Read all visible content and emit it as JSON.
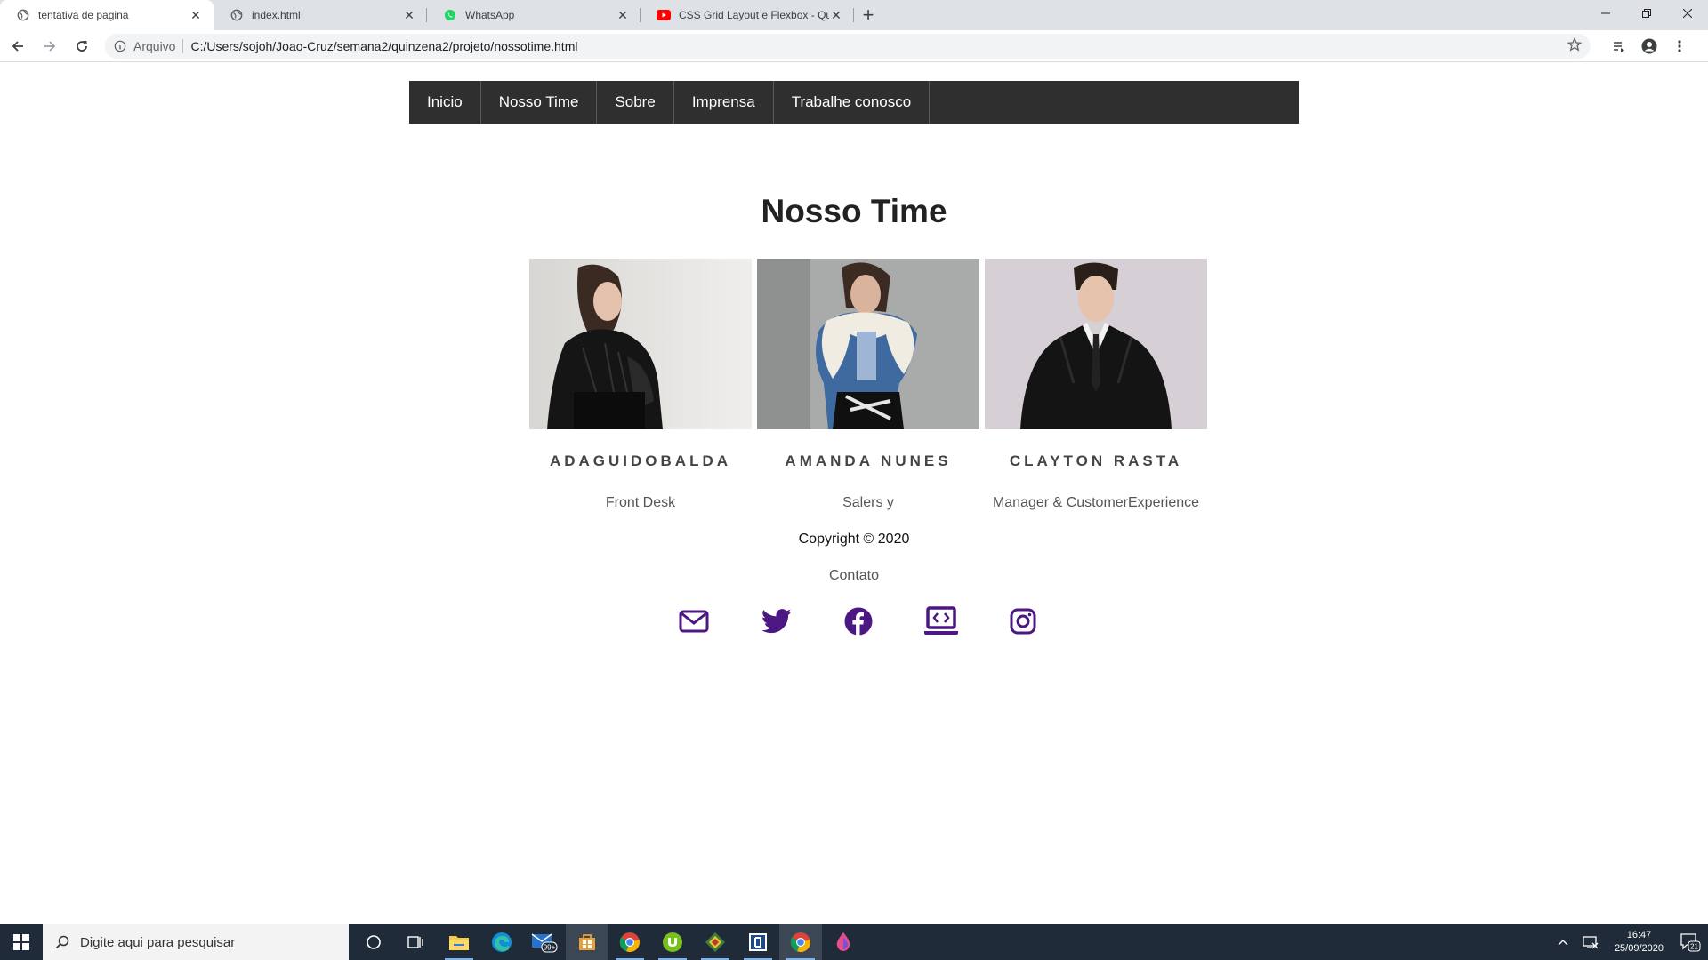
{
  "browser": {
    "tabs": [
      {
        "title": "tentativa de pagina",
        "active": true,
        "favicon": "globe-icon"
      },
      {
        "title": "index.html",
        "active": false,
        "favicon": "globe-icon"
      },
      {
        "title": "WhatsApp",
        "active": false,
        "favicon": "whatsapp-icon"
      },
      {
        "title": "CSS Grid Layout e Flexbox - Qua",
        "active": false,
        "favicon": "youtube-icon"
      }
    ],
    "omnibox": {
      "scheme": "Arquivo",
      "url": "C:/Users/sojoh/Joao-Cruz/semana2/quinzena2/projeto/nossotime.html"
    }
  },
  "page": {
    "nav": [
      "Inicio",
      "Nosso Time",
      "Sobre",
      "Imprensa",
      "Trabalhe conosco"
    ],
    "title": "Nosso Time",
    "members": [
      {
        "name": "ADAGUIDOBALDA",
        "role": "Front Desk"
      },
      {
        "name": "AMANDA NUNES",
        "role": "Salers y"
      },
      {
        "name": "CLAYTON RASTA",
        "role": "Manager & CustomerExperience"
      }
    ],
    "copyright": "Copyright © 2020",
    "contact": "Contato",
    "social_icons": [
      "mail-icon",
      "twitter-icon",
      "facebook-icon",
      "laptop-icon",
      "instagram-icon"
    ],
    "accent_color": "#4b1782",
    "nav_bg": "#2f2f2f"
  },
  "taskbar": {
    "search_placeholder": "Digite aqui para pesquisar",
    "mail_badge": "99+",
    "time": "16:47",
    "date": "25/09/2020",
    "notifications": "21"
  }
}
